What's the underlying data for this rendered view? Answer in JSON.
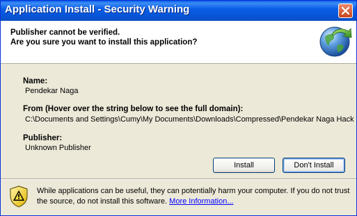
{
  "window": {
    "title": "Application Install - Security Warning",
    "close_label": "Close"
  },
  "header": {
    "line1": "Publisher cannot be verified.",
    "line2": "Are you sure you want to install this application?"
  },
  "fields": {
    "name_label": "Name:",
    "name_value": "Pendekar Naga",
    "from_label": "From (Hover over the string below to see the full domain):",
    "from_value": "C:\\Documents and Settings\\Cumy\\My Documents\\Downloads\\Compressed\\Pendekar Naga Hack",
    "publisher_label": "Publisher:",
    "publisher_value": "Unknown Publisher"
  },
  "buttons": {
    "install": "Install",
    "dont_install": "Don't Install"
  },
  "footer": {
    "warning_text": "While applications can be useful, they can potentially harm your computer. If you do not trust the source, do not install this software.",
    "link_text": "More Information..."
  },
  "icons": {
    "header_icon": "globe-arrow-icon",
    "warning_icon": "warning-shield-icon"
  },
  "colors": {
    "titlebar": "#0a5ee8",
    "dialog_bg": "#ece9d8",
    "link": "#0000ff"
  }
}
